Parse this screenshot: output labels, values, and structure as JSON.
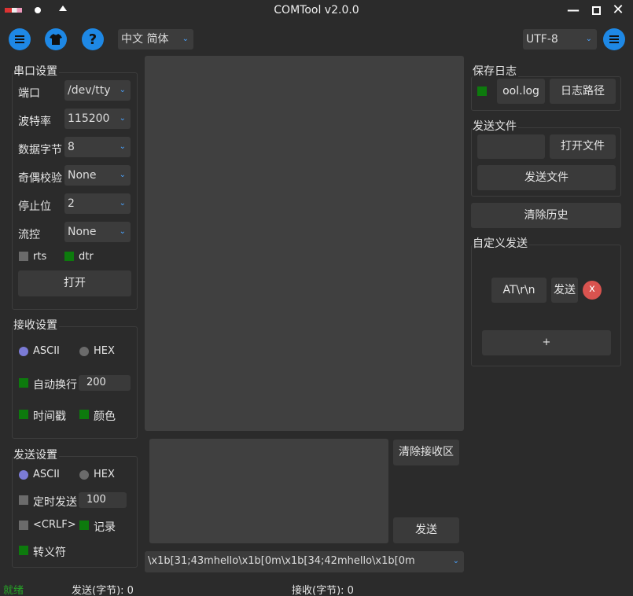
{
  "window": {
    "title": "COMTool v2.0.0"
  },
  "toolbar": {
    "language": "中文 简体",
    "encoding": "UTF-8"
  },
  "serial": {
    "title": "串口设置",
    "port_label": "端口",
    "port_value": "/dev/tty",
    "baud_label": "波特率",
    "baud_value": "115200",
    "bytes_label": "数据字节",
    "bytes_value": "8",
    "parity_label": "奇偶校验",
    "parity_value": "None",
    "stop_label": "停止位",
    "stop_value": "2",
    "flow_label": "流控",
    "flow_value": "None",
    "rts_label": "rts",
    "dtr_label": "dtr",
    "open_label": "打开"
  },
  "receive": {
    "title": "接收设置",
    "ascii_label": "ASCII",
    "hex_label": "HEX",
    "autowrap_label": "自动换行",
    "autowrap_value": "200",
    "timestamp_label": "时间戳",
    "color_label": "颜色"
  },
  "send": {
    "title": "发送设置",
    "ascii_label": "ASCII",
    "hex_label": "HEX",
    "timed_label": "定时发送",
    "timed_value": "100",
    "crlf_label": "<CRLF>",
    "record_label": "记录",
    "escape_label": "转义符"
  },
  "center": {
    "clear_receive_label": "清除接收区",
    "send_label": "发送",
    "history_value": "\\x1b[31;43mhello\\x1b[0m\\x1b[34;42mhello\\x1b[0m"
  },
  "log": {
    "title": "保存日志",
    "file_value": "ool.log",
    "path_label": "日志路径"
  },
  "send_file": {
    "title": "发送文件",
    "open_label": "打开文件",
    "send_label": "发送文件"
  },
  "clear_history_label": "清除历史",
  "custom_send": {
    "title": "自定义发送",
    "item_value": "AT\\r\\n",
    "item_send_label": "发送",
    "item_delete_label": "x",
    "add_label": "+"
  },
  "status": {
    "state": "就绪",
    "sent": "发送(字节): 0",
    "received": "接收(字节): 0"
  },
  "colors": {
    "accent": "#1e88e5",
    "check_on": "#0d7a0d",
    "status_ok": "#27a627",
    "delete": "#d9534f"
  }
}
